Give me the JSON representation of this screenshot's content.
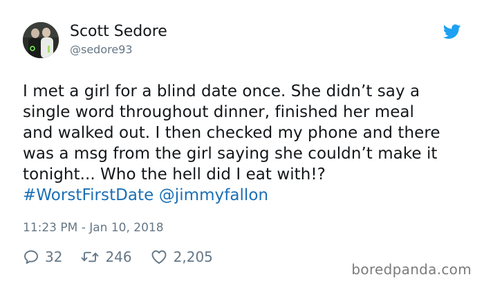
{
  "tweet": {
    "author": {
      "display_name": "Scott Sedore",
      "handle": "@sedore93",
      "avatar_icon": "profile-photo"
    },
    "platform_icon": "twitter-bird-icon",
    "text_lines": [
      "I met a girl for a blind date once. She didn’t say a",
      "single word throughout dinner, finished her meal",
      "and walked out. I then checked my phone and there",
      "was a msg from the girl saying she couldn’t make it",
      "tonight... Who the hell did I eat with!?"
    ],
    "hashtag": "#WorstFirstDate",
    "mention": "@jimmyfallon",
    "timestamp": "11:23 PM - Jan 10, 2018",
    "replies": "32",
    "retweets": "246",
    "likes": "2,205"
  },
  "watermark": "boredpanda.com",
  "colors": {
    "text": "#14171a",
    "secondary": "#657786",
    "link": "#1b6fb5",
    "twitter_blue": "#1da1f2",
    "background": "#ffffff"
  }
}
